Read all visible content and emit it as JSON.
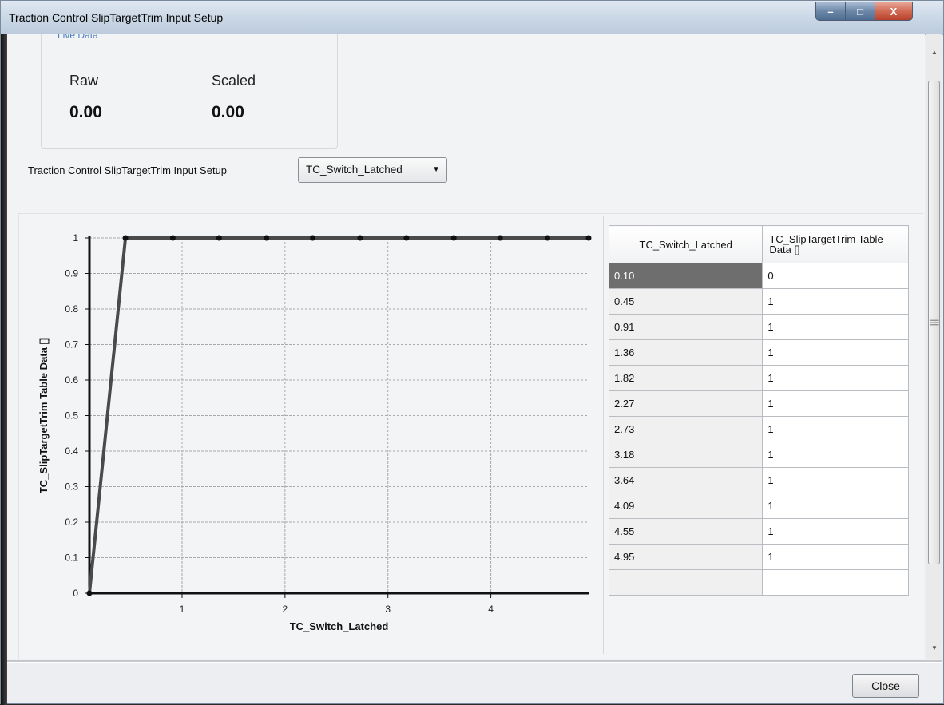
{
  "window": {
    "title": "Traction Control SlipTargetTrim Input Setup",
    "controls": {
      "minimize": "–",
      "maximize": "□",
      "close": "X"
    }
  },
  "live_data": {
    "legend": "Live Data",
    "raw_label": "Raw",
    "raw_value": "0.00",
    "scaled_label": "Scaled",
    "scaled_value": "0.00"
  },
  "setup": {
    "label": "Traction Control SlipTargetTrim Input Setup",
    "selected": "TC_Switch_Latched"
  },
  "table": {
    "col_x": "TC_Switch_Latched",
    "col_y": "TC_SlipTargetTrim Table Data []",
    "rows": [
      {
        "x": "0.10",
        "y": "0"
      },
      {
        "x": "0.45",
        "y": "1"
      },
      {
        "x": "0.91",
        "y": "1"
      },
      {
        "x": "1.36",
        "y": "1"
      },
      {
        "x": "1.82",
        "y": "1"
      },
      {
        "x": "2.27",
        "y": "1"
      },
      {
        "x": "2.73",
        "y": "1"
      },
      {
        "x": "3.18",
        "y": "1"
      },
      {
        "x": "3.64",
        "y": "1"
      },
      {
        "x": "4.09",
        "y": "1"
      },
      {
        "x": "4.55",
        "y": "1"
      },
      {
        "x": "4.95",
        "y": "1"
      }
    ]
  },
  "chart_data": {
    "type": "line",
    "xlabel": "TC_Switch_Latched",
    "ylabel": "TC_SlipTargetTrim Table Data []",
    "x": [
      0.1,
      0.45,
      0.91,
      1.36,
      1.82,
      2.27,
      2.73,
      3.18,
      3.64,
      4.09,
      4.55,
      4.95
    ],
    "y": [
      0,
      1,
      1,
      1,
      1,
      1,
      1,
      1,
      1,
      1,
      1,
      1
    ],
    "xlim": [
      0.1,
      4.95
    ],
    "ylim": [
      0,
      1
    ],
    "xticks": [
      1,
      2,
      3,
      4
    ],
    "yticks": [
      0,
      0.1,
      0.2,
      0.3,
      0.4,
      0.5,
      0.6,
      0.7,
      0.8,
      0.9,
      1
    ],
    "grid": true,
    "colors": {
      "line": "#4a4a4a",
      "grid": "#a9a9a9",
      "axis": "#111111"
    }
  },
  "buttons": {
    "close": "Close"
  }
}
